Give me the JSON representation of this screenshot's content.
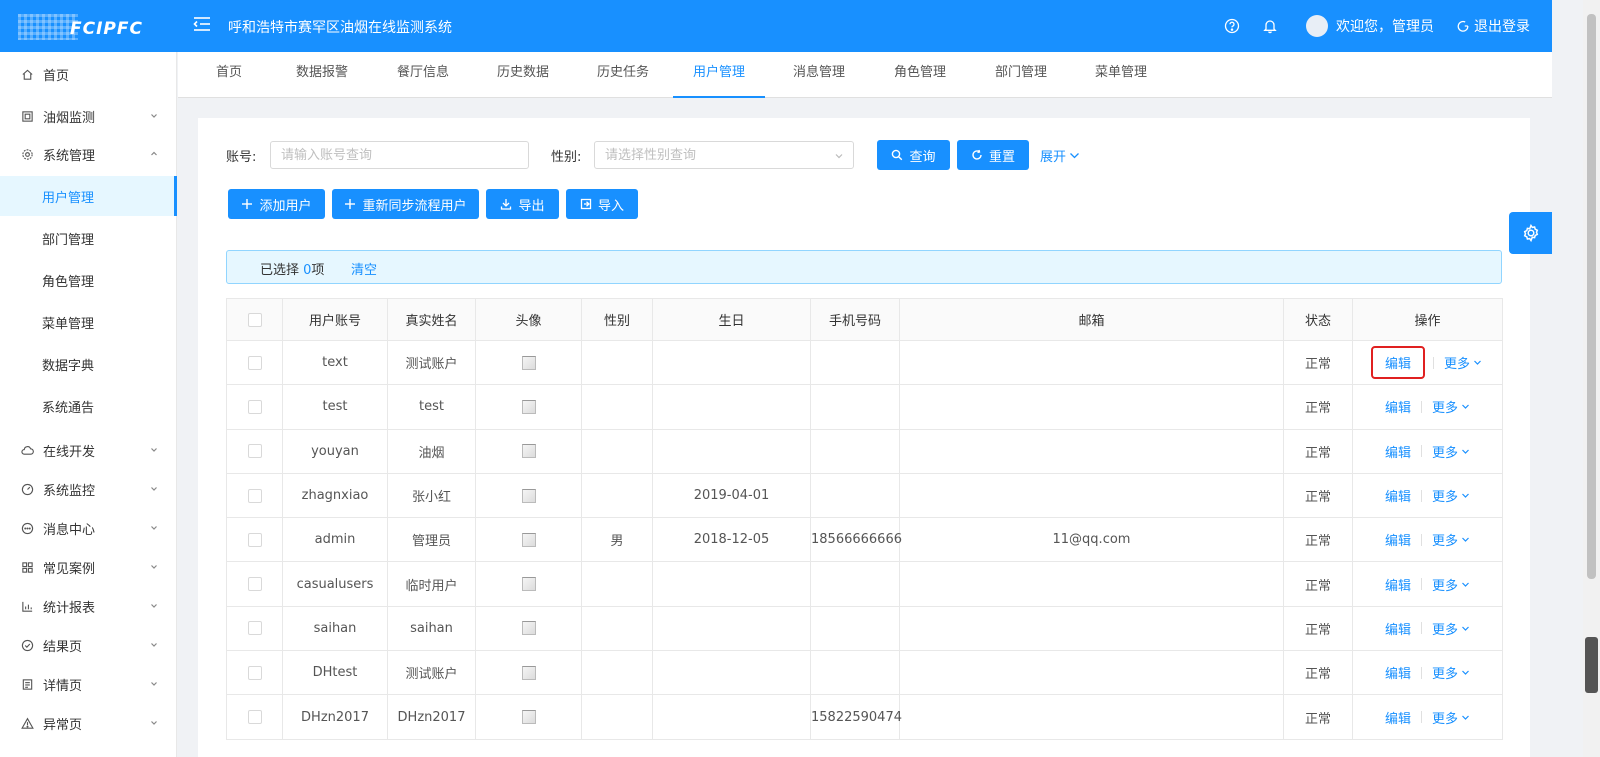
{
  "header": {
    "logo_text": "FCIPFC",
    "system_title": "呼和浩特市赛罕区油烟在线监测系统",
    "welcome": "欢迎您，管理员",
    "logout": "退出登录"
  },
  "sidebar": {
    "items": [
      {
        "label": "首页",
        "icon": "home-icon"
      },
      {
        "label": "油烟监测",
        "icon": "monitor-icon"
      },
      {
        "label": "系统管理",
        "icon": "gear-icon"
      },
      {
        "label": "用户管理"
      },
      {
        "label": "部门管理"
      },
      {
        "label": "角色管理"
      },
      {
        "label": "菜单管理"
      },
      {
        "label": "数据字典"
      },
      {
        "label": "系统通告"
      },
      {
        "label": "在线开发",
        "icon": "cloud-icon"
      },
      {
        "label": "系统监控",
        "icon": "dashboard-icon"
      },
      {
        "label": "消息中心",
        "icon": "message-icon"
      },
      {
        "label": "常见案例",
        "icon": "grid-icon"
      },
      {
        "label": "统计报表",
        "icon": "chart-icon"
      },
      {
        "label": "结果页",
        "icon": "check-circle-icon"
      },
      {
        "label": "详情页",
        "icon": "profile-icon"
      },
      {
        "label": "异常页",
        "icon": "warning-icon"
      }
    ]
  },
  "tabs": [
    "首页",
    "数据报警",
    "餐厅信息",
    "历史数据",
    "历史任务",
    "用户管理",
    "消息管理",
    "角色管理",
    "部门管理",
    "菜单管理"
  ],
  "filters": {
    "account_label": "账号:",
    "account_placeholder": "请输入账号查询",
    "gender_label": "性别:",
    "gender_placeholder": "请选择性别查询",
    "query": "查询",
    "reset": "重置",
    "expand": "展开"
  },
  "toolbar": {
    "add_user": "添加用户",
    "resync": "重新同步流程用户",
    "export": "导出",
    "import": "导入"
  },
  "selection": {
    "prefix": "已选择 ",
    "count": "0",
    "suffix": "项",
    "clear": "清空"
  },
  "table": {
    "headers": [
      "用户账号",
      "真实姓名",
      "头像",
      "性别",
      "生日",
      "手机号码",
      "邮箱",
      "状态",
      "操作"
    ],
    "edit_label": "编辑",
    "more_label": "更多",
    "rows": [
      {
        "account": "text",
        "name": "测试账户",
        "gender": "",
        "birthday": "",
        "phone": "",
        "email": "",
        "status": "正常"
      },
      {
        "account": "test",
        "name": "test",
        "gender": "",
        "birthday": "",
        "phone": "",
        "email": "",
        "status": "正常"
      },
      {
        "account": "youyan",
        "name": "油烟",
        "gender": "",
        "birthday": "",
        "phone": "",
        "email": "",
        "status": "正常"
      },
      {
        "account": "zhagnxiao",
        "name": "张小红",
        "gender": "",
        "birthday": "2019-04-01",
        "phone": "",
        "email": "",
        "status": "正常"
      },
      {
        "account": "admin",
        "name": "管理员",
        "gender": "男",
        "birthday": "2018-12-05",
        "phone": "18566666666",
        "email": "11@qq.com",
        "status": "正常"
      },
      {
        "account": "casualusers",
        "name": "临时用户",
        "gender": "",
        "birthday": "",
        "phone": "",
        "email": "",
        "status": "正常"
      },
      {
        "account": "saihan",
        "name": "saihan",
        "gender": "",
        "birthday": "",
        "phone": "",
        "email": "",
        "status": "正常"
      },
      {
        "account": "DHtest",
        "name": "测试账户",
        "gender": "",
        "birthday": "",
        "phone": "",
        "email": "",
        "status": "正常"
      },
      {
        "account": "DHzn2017",
        "name": "DHzn2017",
        "gender": "",
        "birthday": "",
        "phone": "15822590474",
        "email": "",
        "status": "正常"
      }
    ]
  },
  "colors": {
    "primary": "#1890ff",
    "highlight_box": "#e02020"
  }
}
